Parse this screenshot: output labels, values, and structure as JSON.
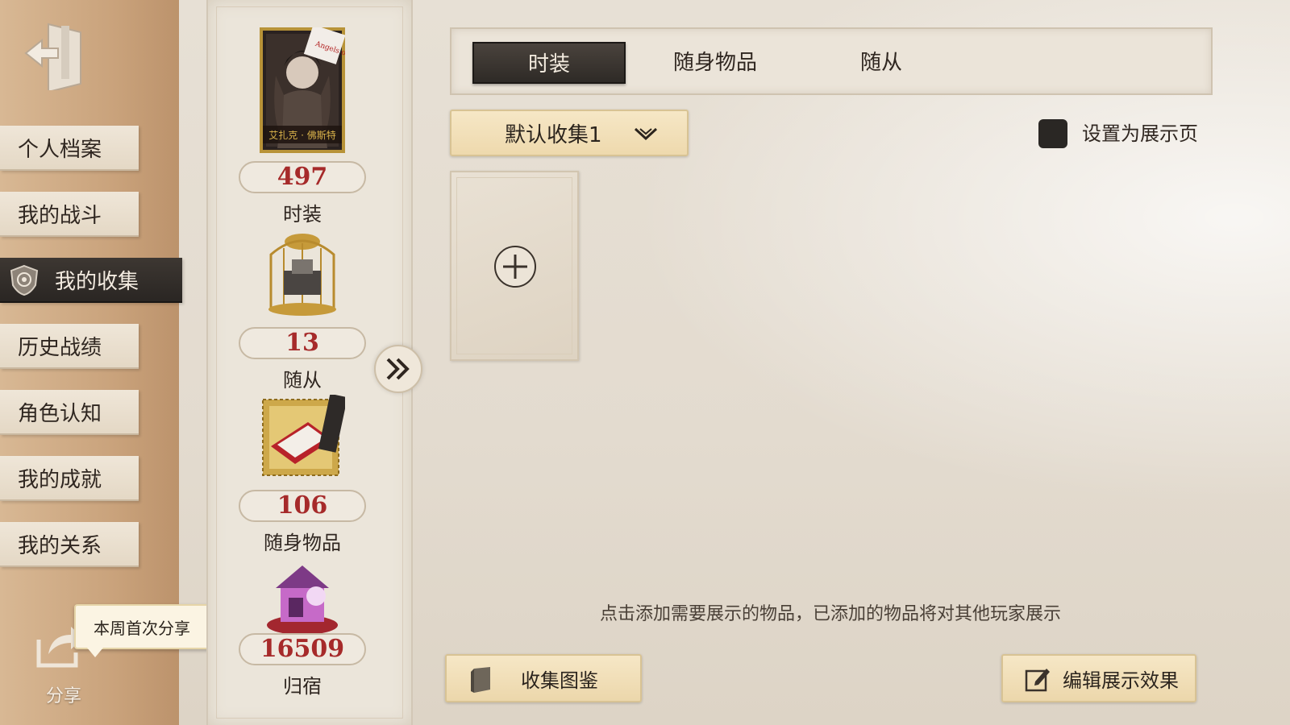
{
  "nav": {
    "items": [
      {
        "label": "个人档案"
      },
      {
        "label": "我的战斗"
      },
      {
        "label": "我的收集"
      },
      {
        "label": "历史战绩"
      },
      {
        "label": "角色认知"
      },
      {
        "label": "我的成就"
      },
      {
        "label": "我的关系"
      }
    ],
    "active_index": 2,
    "share_label": "分享",
    "share_tip": "本周首次分享"
  },
  "stats": [
    {
      "count": "497",
      "label": "时装",
      "image_caption": "艾扎克 · 佛斯特",
      "image_tag": "Angels of Death",
      "icon": "costume-portrait-icon"
    },
    {
      "count": "13",
      "label": "随从",
      "icon": "companion-cage-icon"
    },
    {
      "count": "106",
      "label": "随身物品",
      "icon": "accessory-book-stamp-icon"
    },
    {
      "count": "16509",
      "label": "归宿",
      "icon": "residence-icon"
    }
  ],
  "tabs": [
    {
      "label": "时装",
      "active": true
    },
    {
      "label": "随身物品",
      "active": false
    },
    {
      "label": "随从",
      "active": false
    }
  ],
  "collection_select": {
    "value": "默认收集1"
  },
  "display_toggle_label": "设置为展示页",
  "hint": "点击添加需要展示的物品，已添加的物品将对其他玩家展示",
  "buttons": {
    "collection_guide": "收集图鉴",
    "edit_display": "编辑展示效果"
  },
  "colors": {
    "accent_red": "#a62a2a",
    "active_dark": "#2e2a26",
    "button_gold": "#f0dcb0"
  }
}
